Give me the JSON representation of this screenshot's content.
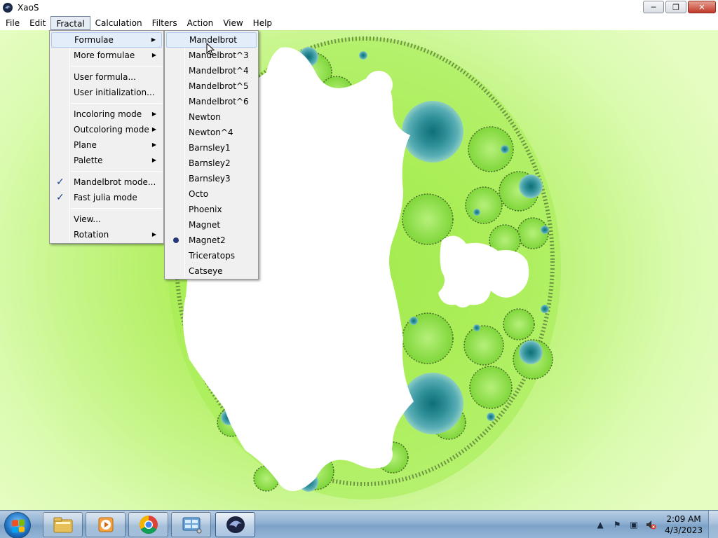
{
  "window": {
    "title": "XaoS"
  },
  "menubar": [
    "File",
    "Edit",
    "Fractal",
    "Calculation",
    "Filters",
    "Action",
    "View",
    "Help"
  ],
  "fractal_menu": {
    "items": [
      {
        "label": "Formulae"
      },
      {
        "label": "More formulae"
      },
      {
        "label": "User formula..."
      },
      {
        "label": "User initialization..."
      },
      {
        "label": "Incoloring mode"
      },
      {
        "label": "Outcoloring mode"
      },
      {
        "label": "Plane"
      },
      {
        "label": "Palette"
      },
      {
        "label": "Mandelbrot mode..."
      },
      {
        "label": "Fast julia mode"
      },
      {
        "label": "View..."
      },
      {
        "label": "Rotation"
      }
    ]
  },
  "formulae_menu": {
    "items": [
      "Mandelbrot",
      "Mandelbrot^3",
      "Mandelbrot^4",
      "Mandelbrot^5",
      "Mandelbrot^6",
      "Newton",
      "Newton^4",
      "Barnsley1",
      "Barnsley2",
      "Barnsley3",
      "Octo",
      "Phoenix",
      "Magnet",
      "Magnet2",
      "Triceratops",
      "Catseye"
    ],
    "selected": "Magnet2",
    "hovered": "Mandelbrot"
  },
  "taskbar": {
    "clock_time": "2:09 AM",
    "clock_date": "4/3/2023"
  },
  "icons": {
    "app": "xaos-icon",
    "minimize": "minimize-icon",
    "maximize": "restore-icon",
    "close": "close-icon"
  }
}
